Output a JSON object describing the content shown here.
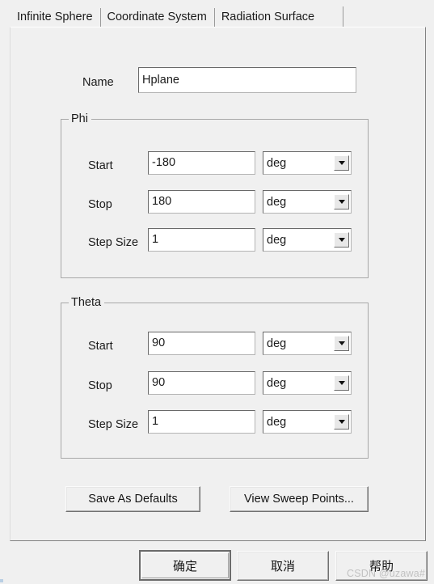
{
  "window": {
    "background_color": "#f0f0f0",
    "accent_color": "#6b6b6b"
  },
  "tabs": [
    {
      "label": "Infinite Sphere",
      "selected": true
    },
    {
      "label": "Coordinate System",
      "selected": false
    },
    {
      "label": "Radiation Surface",
      "selected": false
    }
  ],
  "form": {
    "name_label": "Name",
    "name_value": "Hplane"
  },
  "groups": [
    {
      "title": "Phi",
      "rows": [
        {
          "label": "Start",
          "value": "-180",
          "unit": "deg"
        },
        {
          "label": "Stop",
          "value": "180",
          "unit": "deg"
        },
        {
          "label": "Step Size",
          "value": "1",
          "unit": "deg"
        }
      ]
    },
    {
      "title": "Theta",
      "rows": [
        {
          "label": "Start",
          "value": "90",
          "unit": "deg"
        },
        {
          "label": "Stop",
          "value": "90",
          "unit": "deg"
        },
        {
          "label": "Step Size",
          "value": "1",
          "unit": "deg"
        }
      ]
    }
  ],
  "panel_buttons": [
    {
      "label": "Save As Defaults"
    },
    {
      "label": "View Sweep Points..."
    }
  ],
  "dialog_buttons": [
    {
      "label": "确定",
      "default": true
    },
    {
      "label": "取消",
      "default": false
    },
    {
      "label": "帮助",
      "default": false
    }
  ],
  "icons": {
    "dropdown": "chevron-down-icon"
  },
  "watermark": {
    "text": "CSDN @uzawa#"
  }
}
